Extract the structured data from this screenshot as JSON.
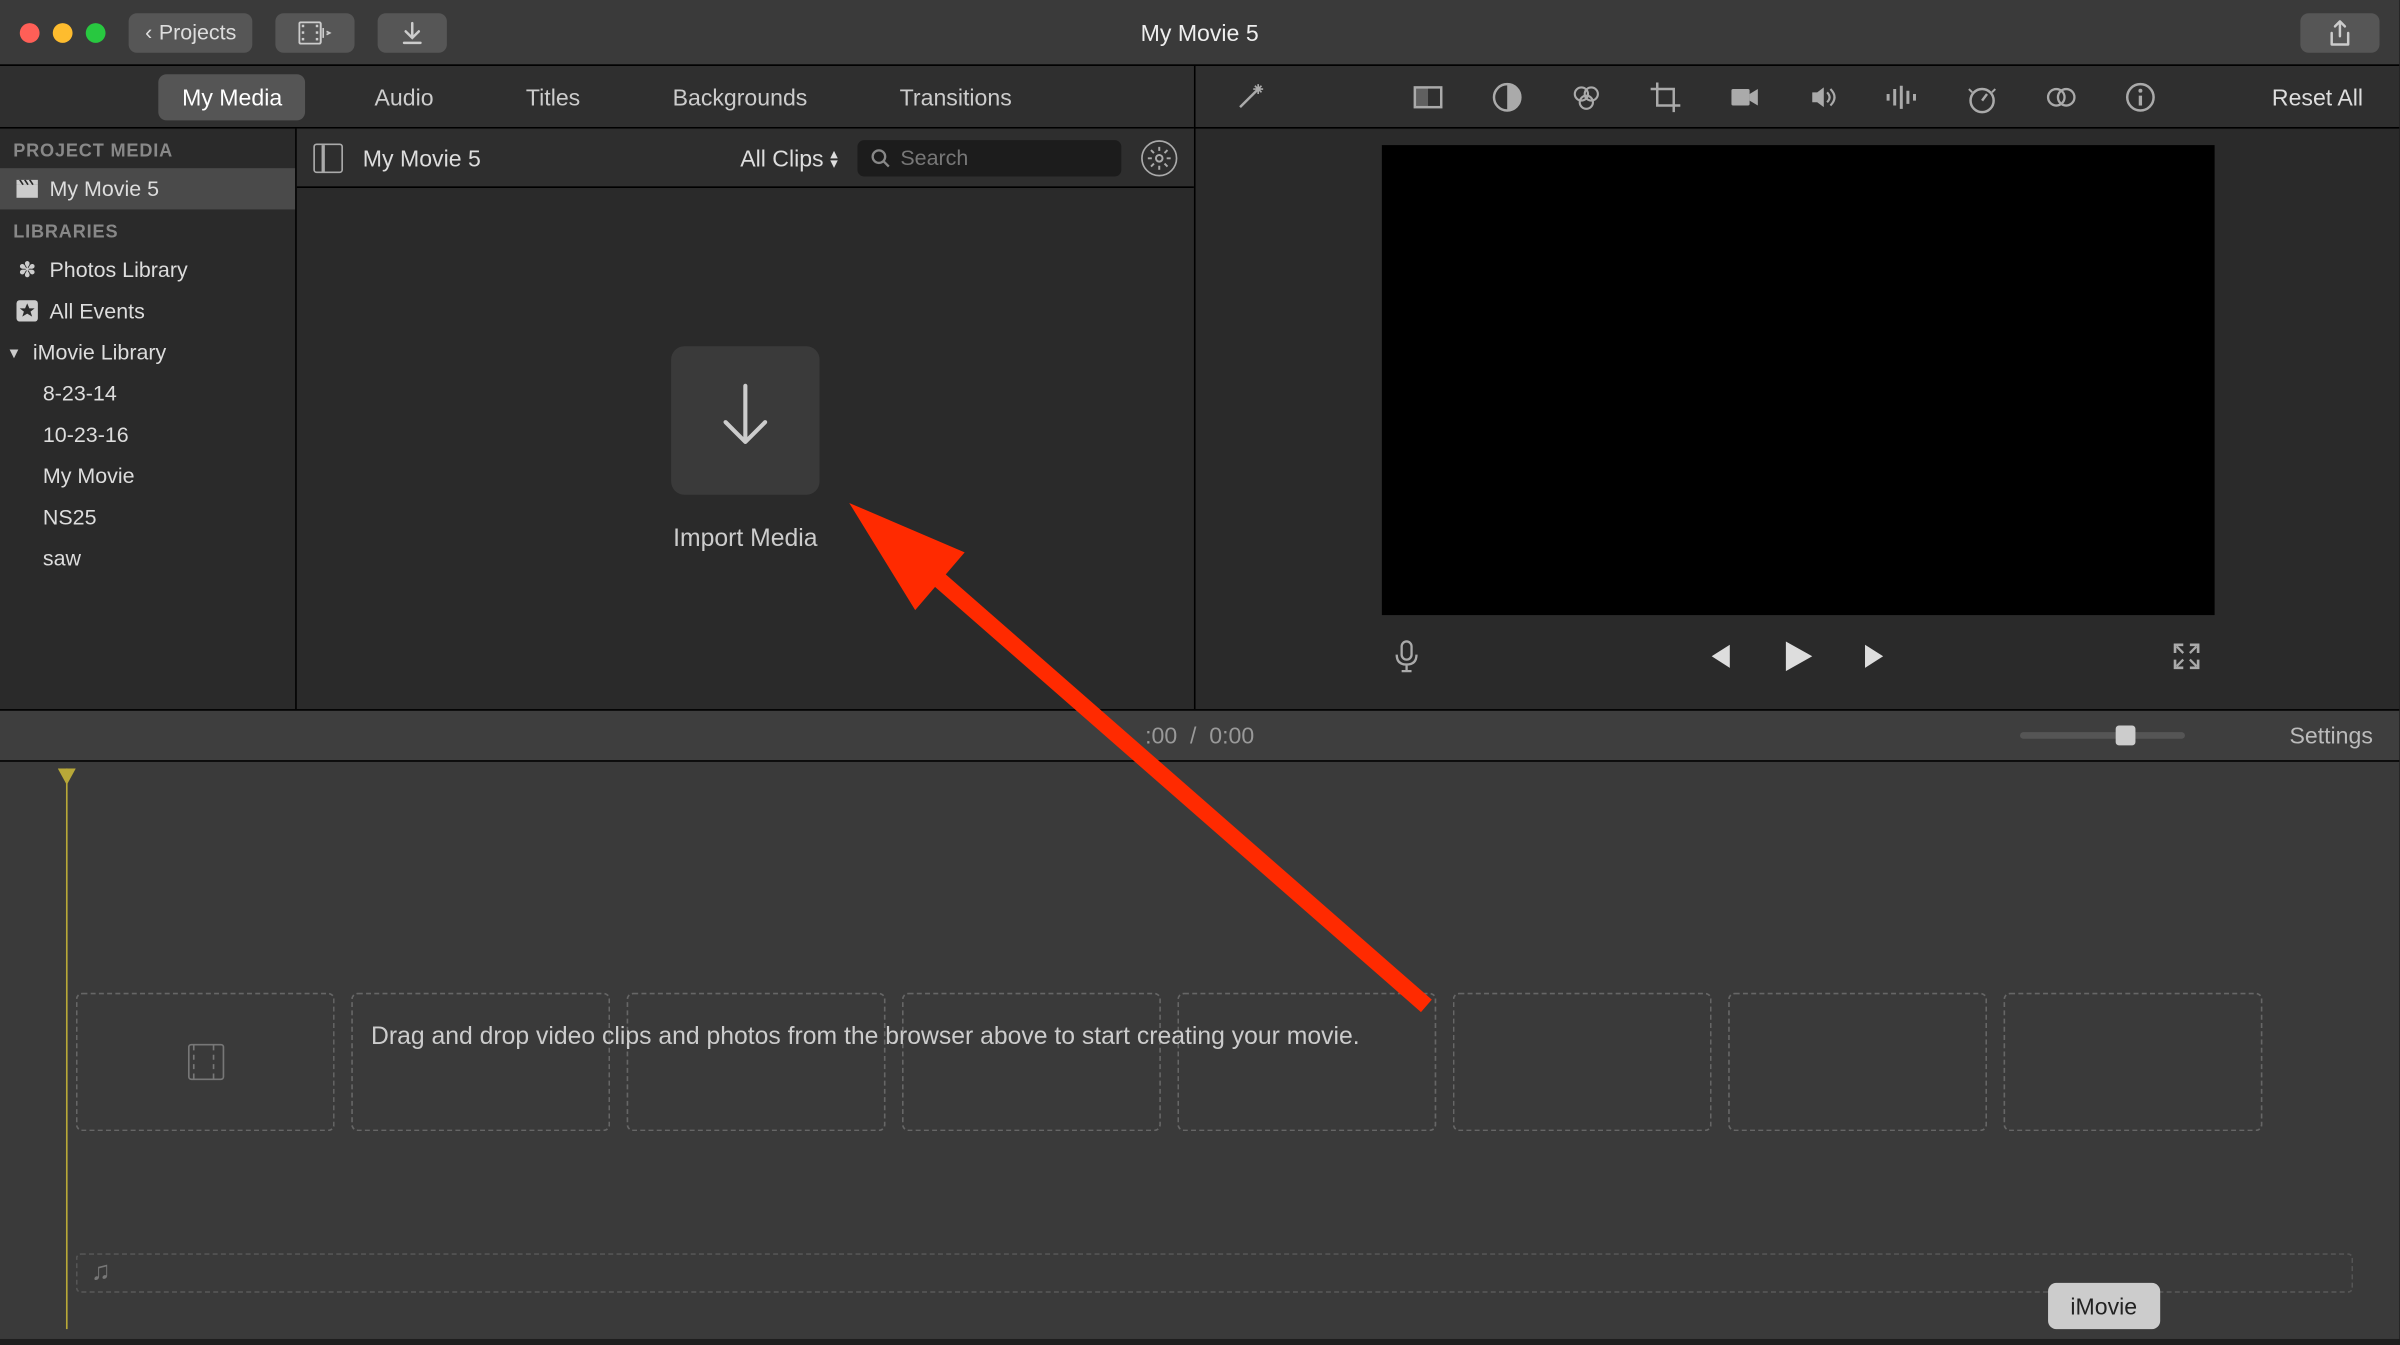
{
  "titlebar": {
    "projects_label": "Projects",
    "title": "My Movie 5"
  },
  "tabs": [
    {
      "label": "My Media",
      "active": true
    },
    {
      "label": "Audio",
      "active": false
    },
    {
      "label": "Titles",
      "active": false
    },
    {
      "label": "Backgrounds",
      "active": false
    },
    {
      "label": "Transitions",
      "active": false
    }
  ],
  "sidebar": {
    "project_media_header": "PROJECT MEDIA",
    "project_item": "My Movie 5",
    "libraries_header": "LIBRARIES",
    "photos_library": "Photos Library",
    "all_events": "All Events",
    "imovie_library": "iMovie Library",
    "events": [
      "8-23-14",
      "10-23-16",
      "My Movie",
      "NS25",
      "saw"
    ]
  },
  "browser": {
    "project_name": "My Movie 5",
    "filter_label": "All Clips",
    "search_placeholder": "Search",
    "import_label": "Import Media"
  },
  "inspector": {
    "reset_all_label": "Reset All",
    "icons": [
      "magic-wand-icon",
      "crop-rect-icon",
      "color-balance-icon",
      "color-wheel-icon",
      "crop-icon",
      "camera-icon",
      "volume-icon",
      "audio-eq-icon",
      "speed-icon",
      "noise-icon",
      "info-icon"
    ]
  },
  "timebar": {
    "current": ":00",
    "separator": "/",
    "total": "0:00",
    "settings_label": "Settings"
  },
  "timeline": {
    "hint": "Drag and drop video clips and photos from the browser above to start creating your movie."
  },
  "badge": {
    "label": "iMovie"
  }
}
